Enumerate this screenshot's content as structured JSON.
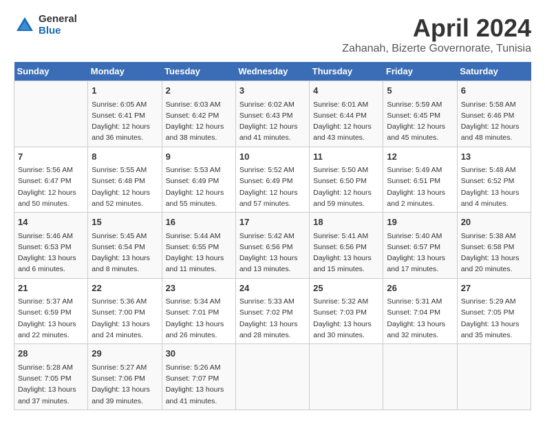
{
  "header": {
    "logo_general": "General",
    "logo_blue": "Blue",
    "title": "April 2024",
    "subtitle": "Zahanah, Bizerte Governorate, Tunisia"
  },
  "calendar": {
    "weekdays": [
      "Sunday",
      "Monday",
      "Tuesday",
      "Wednesday",
      "Thursday",
      "Friday",
      "Saturday"
    ],
    "weeks": [
      [
        {
          "day": "",
          "info": ""
        },
        {
          "day": "1",
          "info": "Sunrise: 6:05 AM\nSunset: 6:41 PM\nDaylight: 12 hours\nand 36 minutes."
        },
        {
          "day": "2",
          "info": "Sunrise: 6:03 AM\nSunset: 6:42 PM\nDaylight: 12 hours\nand 38 minutes."
        },
        {
          "day": "3",
          "info": "Sunrise: 6:02 AM\nSunset: 6:43 PM\nDaylight: 12 hours\nand 41 minutes."
        },
        {
          "day": "4",
          "info": "Sunrise: 6:01 AM\nSunset: 6:44 PM\nDaylight: 12 hours\nand 43 minutes."
        },
        {
          "day": "5",
          "info": "Sunrise: 5:59 AM\nSunset: 6:45 PM\nDaylight: 12 hours\nand 45 minutes."
        },
        {
          "day": "6",
          "info": "Sunrise: 5:58 AM\nSunset: 6:46 PM\nDaylight: 12 hours\nand 48 minutes."
        }
      ],
      [
        {
          "day": "7",
          "info": "Sunrise: 5:56 AM\nSunset: 6:47 PM\nDaylight: 12 hours\nand 50 minutes."
        },
        {
          "day": "8",
          "info": "Sunrise: 5:55 AM\nSunset: 6:48 PM\nDaylight: 12 hours\nand 52 minutes."
        },
        {
          "day": "9",
          "info": "Sunrise: 5:53 AM\nSunset: 6:49 PM\nDaylight: 12 hours\nand 55 minutes."
        },
        {
          "day": "10",
          "info": "Sunrise: 5:52 AM\nSunset: 6:49 PM\nDaylight: 12 hours\nand 57 minutes."
        },
        {
          "day": "11",
          "info": "Sunrise: 5:50 AM\nSunset: 6:50 PM\nDaylight: 12 hours\nand 59 minutes."
        },
        {
          "day": "12",
          "info": "Sunrise: 5:49 AM\nSunset: 6:51 PM\nDaylight: 13 hours\nand 2 minutes."
        },
        {
          "day": "13",
          "info": "Sunrise: 5:48 AM\nSunset: 6:52 PM\nDaylight: 13 hours\nand 4 minutes."
        }
      ],
      [
        {
          "day": "14",
          "info": "Sunrise: 5:46 AM\nSunset: 6:53 PM\nDaylight: 13 hours\nand 6 minutes."
        },
        {
          "day": "15",
          "info": "Sunrise: 5:45 AM\nSunset: 6:54 PM\nDaylight: 13 hours\nand 8 minutes."
        },
        {
          "day": "16",
          "info": "Sunrise: 5:44 AM\nSunset: 6:55 PM\nDaylight: 13 hours\nand 11 minutes."
        },
        {
          "day": "17",
          "info": "Sunrise: 5:42 AM\nSunset: 6:56 PM\nDaylight: 13 hours\nand 13 minutes."
        },
        {
          "day": "18",
          "info": "Sunrise: 5:41 AM\nSunset: 6:56 PM\nDaylight: 13 hours\nand 15 minutes."
        },
        {
          "day": "19",
          "info": "Sunrise: 5:40 AM\nSunset: 6:57 PM\nDaylight: 13 hours\nand 17 minutes."
        },
        {
          "day": "20",
          "info": "Sunrise: 5:38 AM\nSunset: 6:58 PM\nDaylight: 13 hours\nand 20 minutes."
        }
      ],
      [
        {
          "day": "21",
          "info": "Sunrise: 5:37 AM\nSunset: 6:59 PM\nDaylight: 13 hours\nand 22 minutes."
        },
        {
          "day": "22",
          "info": "Sunrise: 5:36 AM\nSunset: 7:00 PM\nDaylight: 13 hours\nand 24 minutes."
        },
        {
          "day": "23",
          "info": "Sunrise: 5:34 AM\nSunset: 7:01 PM\nDaylight: 13 hours\nand 26 minutes."
        },
        {
          "day": "24",
          "info": "Sunrise: 5:33 AM\nSunset: 7:02 PM\nDaylight: 13 hours\nand 28 minutes."
        },
        {
          "day": "25",
          "info": "Sunrise: 5:32 AM\nSunset: 7:03 PM\nDaylight: 13 hours\nand 30 minutes."
        },
        {
          "day": "26",
          "info": "Sunrise: 5:31 AM\nSunset: 7:04 PM\nDaylight: 13 hours\nand 32 minutes."
        },
        {
          "day": "27",
          "info": "Sunrise: 5:29 AM\nSunset: 7:05 PM\nDaylight: 13 hours\nand 35 minutes."
        }
      ],
      [
        {
          "day": "28",
          "info": "Sunrise: 5:28 AM\nSunset: 7:05 PM\nDaylight: 13 hours\nand 37 minutes."
        },
        {
          "day": "29",
          "info": "Sunrise: 5:27 AM\nSunset: 7:06 PM\nDaylight: 13 hours\nand 39 minutes."
        },
        {
          "day": "30",
          "info": "Sunrise: 5:26 AM\nSunset: 7:07 PM\nDaylight: 13 hours\nand 41 minutes."
        },
        {
          "day": "",
          "info": ""
        },
        {
          "day": "",
          "info": ""
        },
        {
          "day": "",
          "info": ""
        },
        {
          "day": "",
          "info": ""
        }
      ]
    ]
  }
}
